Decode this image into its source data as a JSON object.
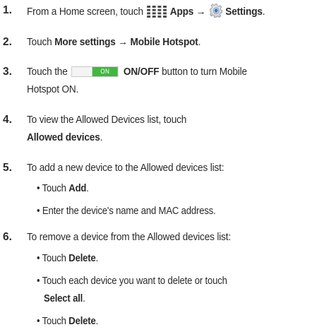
{
  "steps": [
    {
      "number": "1.",
      "prefix": "From a Home screen, touch",
      "apps_label": "Apps",
      "arrow": "→",
      "settings_label": "Settings",
      "suffix": ".",
      "icons": [
        "apps-grid-icon",
        "settings-gear-icon"
      ]
    },
    {
      "number": "2.",
      "prefix": "Touch",
      "more_settings": "More settings",
      "arrow": "→",
      "mobile_hotspot": "Mobile Hotspot",
      "suffix": "."
    },
    {
      "number": "3.",
      "prefix": "Touch the",
      "toggle_text": "ON",
      "toggle_color": "#3fb93f",
      "button_label": "ON/OFF",
      "suffix_line1": "button to turn Mobile",
      "line2": "Hotspot ON."
    },
    {
      "number": "4.",
      "line1": "To view the Allowed Devices list, touch",
      "line2_bold": "Allowed devices",
      "line2_suffix": "."
    },
    {
      "number": "5.",
      "line1": "To add a new device to the Allowed devices list:",
      "bullets": [
        {
          "prefix": "• Touch ",
          "bold": "Add",
          "suffix": "."
        },
        {
          "text": "• Enter the device's name and MAC address."
        }
      ]
    },
    {
      "number": "6.",
      "line1": "To remove a device from the Allowed devices list:",
      "bullets": [
        {
          "prefix": "• Touch ",
          "bold": "Delete",
          "suffix": "."
        },
        {
          "line1": "• Touch each device you want to delete or touch",
          "line2_bold": "Select all",
          "line2_suffix": "."
        },
        {
          "prefix": "• Touch ",
          "bold": "Delete",
          "suffix": "."
        }
      ]
    }
  ]
}
